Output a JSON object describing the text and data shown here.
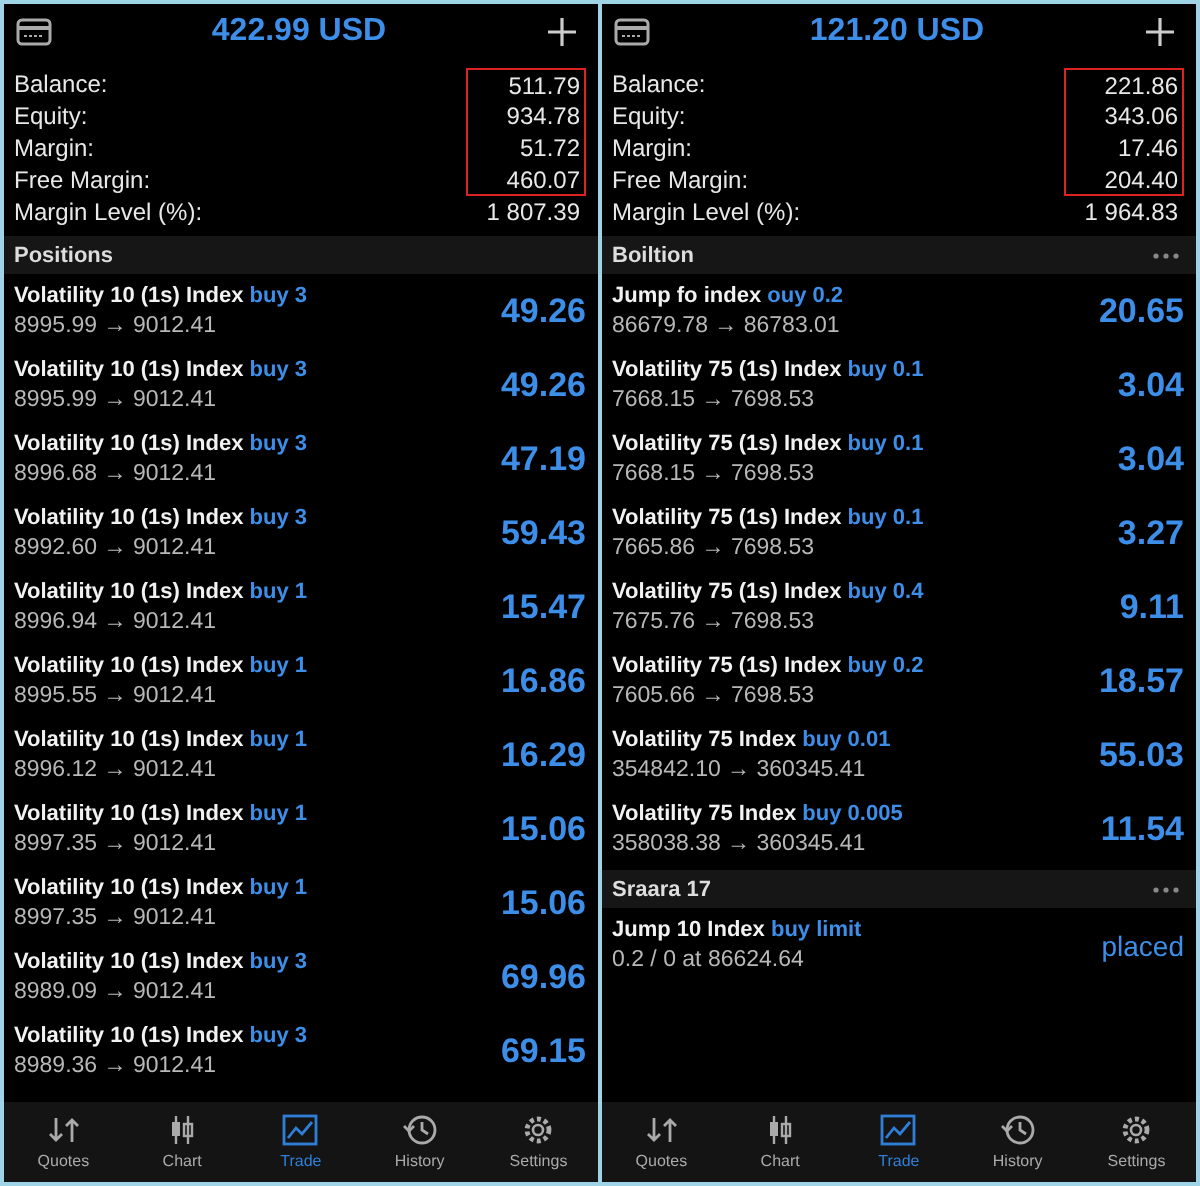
{
  "panels": [
    {
      "title": "422.99 USD",
      "summary": [
        {
          "label": "Balance:",
          "value": "511.79",
          "highlighted": true
        },
        {
          "label": "Equity:",
          "value": "934.78",
          "highlighted": true
        },
        {
          "label": "Margin:",
          "value": "51.72",
          "highlighted": true
        },
        {
          "label": "Free Margin:",
          "value": "460.07",
          "highlighted": true
        },
        {
          "label": "Margin Level (%):",
          "value": "1 807.39",
          "highlighted": false
        }
      ],
      "sections": [
        {
          "title": "Positions",
          "menu": false,
          "items": [
            {
              "kind": "position",
              "symbol": "Volatility 10 (1s) Index",
              "side": "buy 3",
              "prices": "8995.99 → 9012.41",
              "result": "49.26"
            },
            {
              "kind": "position",
              "symbol": "Volatility 10 (1s) Index",
              "side": "buy 3",
              "prices": "8995.99 → 9012.41",
              "result": "49.26"
            },
            {
              "kind": "position",
              "symbol": "Volatility 10 (1s) Index",
              "side": "buy 3",
              "prices": "8996.68 → 9012.41",
              "result": "47.19"
            },
            {
              "kind": "position",
              "symbol": "Volatility 10 (1s) Index",
              "side": "buy 3",
              "prices": "8992.60 → 9012.41",
              "result": "59.43"
            },
            {
              "kind": "position",
              "symbol": "Volatility 10 (1s) Index",
              "side": "buy 1",
              "prices": "8996.94 → 9012.41",
              "result": "15.47"
            },
            {
              "kind": "position",
              "symbol": "Volatility 10 (1s) Index",
              "side": "buy 1",
              "prices": "8995.55 → 9012.41",
              "result": "16.86"
            },
            {
              "kind": "position",
              "symbol": "Volatility 10 (1s) Index",
              "side": "buy 1",
              "prices": "8996.12 → 9012.41",
              "result": "16.29"
            },
            {
              "kind": "position",
              "symbol": "Volatility 10 (1s) Index",
              "side": "buy 1",
              "prices": "8997.35 → 9012.41",
              "result": "15.06"
            },
            {
              "kind": "position",
              "symbol": "Volatility 10 (1s) Index",
              "side": "buy 1",
              "prices": "8997.35 → 9012.41",
              "result": "15.06"
            },
            {
              "kind": "position",
              "symbol": "Volatility 10 (1s) Index",
              "side": "buy 3",
              "prices": "8989.09 → 9012.41",
              "result": "69.96"
            },
            {
              "kind": "position",
              "symbol": "Volatility 10 (1s) Index",
              "side": "buy 3",
              "prices": "8989.36 → 9012.41",
              "result": "69.15"
            }
          ]
        }
      ],
      "tabs": [
        {
          "label": "Quotes",
          "selected": false
        },
        {
          "label": "Chart",
          "selected": false
        },
        {
          "label": "Trade",
          "selected": true
        },
        {
          "label": "History",
          "selected": false
        },
        {
          "label": "Settings",
          "selected": false
        }
      ]
    },
    {
      "title": "121.20 USD",
      "summary": [
        {
          "label": "Balance:",
          "value": "221.86",
          "highlighted": true
        },
        {
          "label": "Equity:",
          "value": "343.06",
          "highlighted": true
        },
        {
          "label": "Margin:",
          "value": "17.46",
          "highlighted": true
        },
        {
          "label": "Free Margin:",
          "value": "204.40",
          "highlighted": true
        },
        {
          "label": "Margin Level (%):",
          "value": "1 964.83",
          "highlighted": false
        }
      ],
      "sections": [
        {
          "title": "Boiltion",
          "menu": true,
          "items": [
            {
              "kind": "position",
              "symbol": "Jump fo index",
              "side": "ouy 0.2",
              "prices": "86679.78 → 86783.01",
              "result": "20.65"
            },
            {
              "kind": "position",
              "symbol": "Volatility 75 (1s) Index",
              "side": "buy 0.1",
              "prices": "7668.15 → 7698.53",
              "result": "3.04"
            },
            {
              "kind": "position",
              "symbol": "Volatility 75 (1s) Index",
              "side": "buy 0.1",
              "prices": "7668.15 → 7698.53",
              "result": "3.04"
            },
            {
              "kind": "position",
              "symbol": "Volatility 75 (1s) Index",
              "side": "buy 0.1",
              "prices": "7665.86 → 7698.53",
              "result": "3.27"
            },
            {
              "kind": "position",
              "symbol": "Volatility 75 (1s) Index",
              "side": "buy 0.4",
              "prices": "7675.76 → 7698.53",
              "result": "9.11"
            },
            {
              "kind": "position",
              "symbol": "Volatility 75 (1s) Index",
              "side": "buy 0.2",
              "prices": "7605.66 → 7698.53",
              "result": "18.57"
            },
            {
              "kind": "position",
              "symbol": "Volatility 75 Index",
              "side": "buy 0.01",
              "prices": "354842.10 → 360345.41",
              "result": "55.03"
            },
            {
              "kind": "position",
              "symbol": "Volatility 75 Index",
              "side": "buy 0.005",
              "prices": "358038.38 → 360345.41",
              "result": "11.54"
            }
          ]
        },
        {
          "title": "Sraara 17",
          "menu": true,
          "items": [
            {
              "kind": "order",
              "symbol": "Jump 10 Index",
              "side": "buy limit",
              "prices": "0.2 / 0 at 86624.64",
              "result": "placed"
            }
          ]
        }
      ],
      "tabs": [
        {
          "label": "Quotes",
          "selected": false
        },
        {
          "label": "Chart",
          "selected": false
        },
        {
          "label": "Trade",
          "selected": true
        },
        {
          "label": "History",
          "selected": false
        },
        {
          "label": "Settings",
          "selected": false
        }
      ]
    }
  ]
}
